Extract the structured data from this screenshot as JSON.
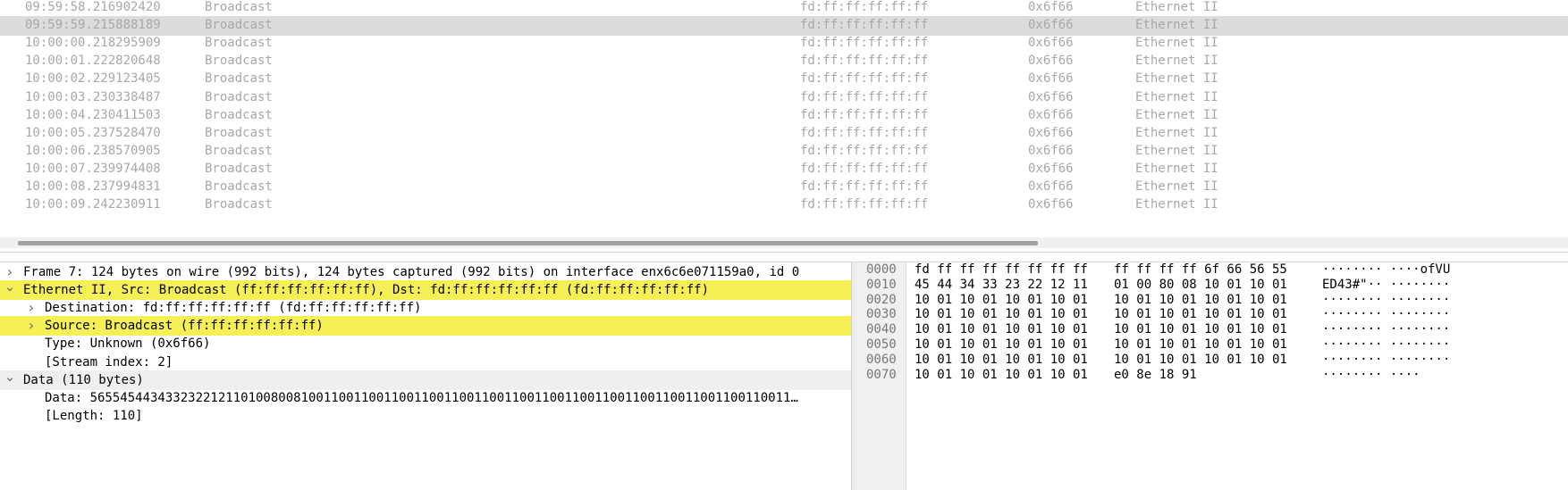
{
  "packet_list": {
    "rows": [
      {
        "time": "09:59:58.216902420",
        "source": "Broadcast",
        "destination": "fd:ff:ff:ff:ff:ff",
        "protocol": "0x6f66",
        "info": "Ethernet II",
        "selected": false
      },
      {
        "time": "09:59:59.215888189",
        "source": "Broadcast",
        "destination": "fd:ff:ff:ff:ff:ff",
        "protocol": "0x6f66",
        "info": "Ethernet II",
        "selected": true
      },
      {
        "time": "10:00:00.218295909",
        "source": "Broadcast",
        "destination": "fd:ff:ff:ff:ff:ff",
        "protocol": "0x6f66",
        "info": "Ethernet II",
        "selected": false
      },
      {
        "time": "10:00:01.222820648",
        "source": "Broadcast",
        "destination": "fd:ff:ff:ff:ff:ff",
        "protocol": "0x6f66",
        "info": "Ethernet II",
        "selected": false
      },
      {
        "time": "10:00:02.229123405",
        "source": "Broadcast",
        "destination": "fd:ff:ff:ff:ff:ff",
        "protocol": "0x6f66",
        "info": "Ethernet II",
        "selected": false
      },
      {
        "time": "10:00:03.230338487",
        "source": "Broadcast",
        "destination": "fd:ff:ff:ff:ff:ff",
        "protocol": "0x6f66",
        "info": "Ethernet II",
        "selected": false
      },
      {
        "time": "10:00:04.230411503",
        "source": "Broadcast",
        "destination": "fd:ff:ff:ff:ff:ff",
        "protocol": "0x6f66",
        "info": "Ethernet II",
        "selected": false
      },
      {
        "time": "10:00:05.237528470",
        "source": "Broadcast",
        "destination": "fd:ff:ff:ff:ff:ff",
        "protocol": "0x6f66",
        "info": "Ethernet II",
        "selected": false
      },
      {
        "time": "10:00:06.238570905",
        "source": "Broadcast",
        "destination": "fd:ff:ff:ff:ff:ff",
        "protocol": "0x6f66",
        "info": "Ethernet II",
        "selected": false
      },
      {
        "time": "10:00:07.239974408",
        "source": "Broadcast",
        "destination": "fd:ff:ff:ff:ff:ff",
        "protocol": "0x6f66",
        "info": "Ethernet II",
        "selected": false
      },
      {
        "time": "10:00:08.237994831",
        "source": "Broadcast",
        "destination": "fd:ff:ff:ff:ff:ff",
        "protocol": "0x6f66",
        "info": "Ethernet II",
        "selected": false
      },
      {
        "time": "10:00:09.242230911",
        "source": "Broadcast",
        "destination": "fd:ff:ff:ff:ff:ff",
        "protocol": "0x6f66",
        "info": "Ethernet II",
        "selected": false
      }
    ]
  },
  "details": {
    "items": [
      {
        "text": "Frame 7: 124 bytes on wire (992 bits), 124 bytes captured (992 bits) on interface enx6c6e071159a0, id 0",
        "level": 0,
        "arrow": "collapsed",
        "style": "normal"
      },
      {
        "text": "Ethernet II, Src: Broadcast (ff:ff:ff:ff:ff:ff), Dst: fd:ff:ff:ff:ff:ff (fd:ff:ff:ff:ff:ff)",
        "level": 0,
        "arrow": "expanded",
        "style": "highlight"
      },
      {
        "text": "Destination: fd:ff:ff:ff:ff:ff (fd:ff:ff:ff:ff:ff)",
        "level": 1,
        "arrow": "collapsed",
        "style": "normal"
      },
      {
        "text": "Source: Broadcast (ff:ff:ff:ff:ff:ff)",
        "level": 1,
        "arrow": "collapsed",
        "style": "highlight"
      },
      {
        "text": "Type: Unknown (0x6f66)",
        "level": 1,
        "arrow": "none",
        "style": "normal"
      },
      {
        "text": "[Stream index: 2]",
        "level": 1,
        "arrow": "none",
        "style": "normal"
      },
      {
        "text": "Data (110 bytes)",
        "level": 0,
        "arrow": "expanded",
        "style": "grey"
      },
      {
        "text": "Data: 565545443433232212110100800810011001100110011001100110011001100110011001100110011001100110011…",
        "level": 1,
        "arrow": "none",
        "style": "normal"
      },
      {
        "text": "[Length: 110]",
        "level": 1,
        "arrow": "none",
        "style": "normal"
      }
    ]
  },
  "hex": {
    "rows": [
      {
        "offset": "0000",
        "bytes1": "fd ff ff ff ff ff ff ff",
        "bytes2": "ff ff ff ff 6f 66 56 55",
        "ascii": "········ ····ofVU"
      },
      {
        "offset": "0010",
        "bytes1": "45 44 34 33 23 22 12 11",
        "bytes2": "01 00 80 08 10 01 10 01",
        "ascii": "ED43#\"·· ········"
      },
      {
        "offset": "0020",
        "bytes1": "10 01 10 01 10 01 10 01",
        "bytes2": "10 01 10 01 10 01 10 01",
        "ascii": "········ ········"
      },
      {
        "offset": "0030",
        "bytes1": "10 01 10 01 10 01 10 01",
        "bytes2": "10 01 10 01 10 01 10 01",
        "ascii": "········ ········"
      },
      {
        "offset": "0040",
        "bytes1": "10 01 10 01 10 01 10 01",
        "bytes2": "10 01 10 01 10 01 10 01",
        "ascii": "········ ········"
      },
      {
        "offset": "0050",
        "bytes1": "10 01 10 01 10 01 10 01",
        "bytes2": "10 01 10 01 10 01 10 01",
        "ascii": "········ ········"
      },
      {
        "offset": "0060",
        "bytes1": "10 01 10 01 10 01 10 01",
        "bytes2": "10 01 10 01 10 01 10 01",
        "ascii": "········ ········"
      },
      {
        "offset": "0070",
        "bytes1": "10 01 10 01 10 01 10 01",
        "bytes2": "e0 8e 18 91",
        "ascii": "········ ····"
      }
    ]
  },
  "colors": {
    "highlight": "#f5f055",
    "selected_row": "#dcdcdc",
    "dim_text": "#a8a8a8"
  },
  "icons": {
    "collapsed": "chevron-right-icon",
    "expanded": "chevron-down-icon"
  }
}
